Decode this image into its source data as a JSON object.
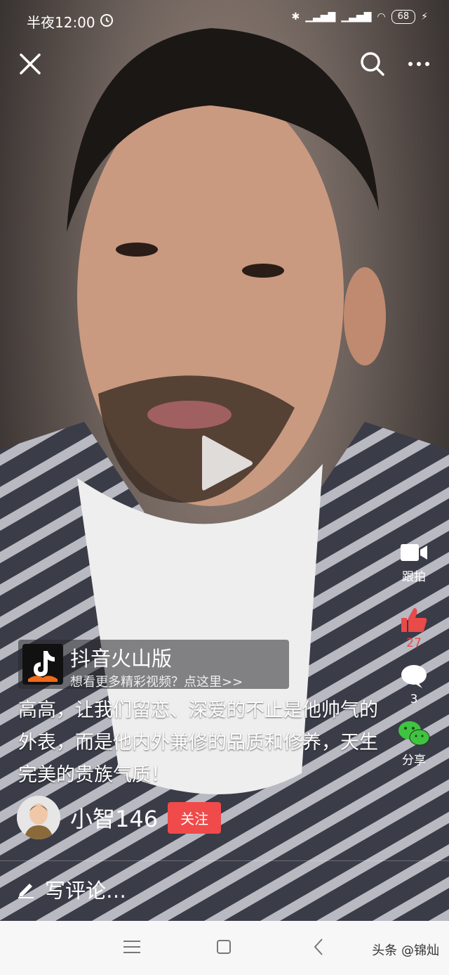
{
  "status_bar": {
    "time": "半夜12:00",
    "battery": "68"
  },
  "top_bar": {
    "close_icon": "close-icon",
    "search_icon": "search-icon",
    "more_icon": "more-dots-icon"
  },
  "video": {
    "play_icon": "play-icon"
  },
  "actions": {
    "film_label": "跟拍",
    "like_count": "27",
    "comment_count": "3",
    "share_label": "分享",
    "like_color": "#e94a4a"
  },
  "promo": {
    "title": "抖音火山版",
    "subtitle": "想看更多精彩视频？点这里>>"
  },
  "caption": "高高，让我们留恋、深爱的不止是他帅气的外表，而是他内外兼修的品质和修养，天生完美的贵族气质！",
  "user": {
    "name": "小智146",
    "follow_label": "关注",
    "follow_color": "#f04a4a"
  },
  "comment": {
    "placeholder": "写评论…"
  },
  "watermark": "头条 @锦灿"
}
